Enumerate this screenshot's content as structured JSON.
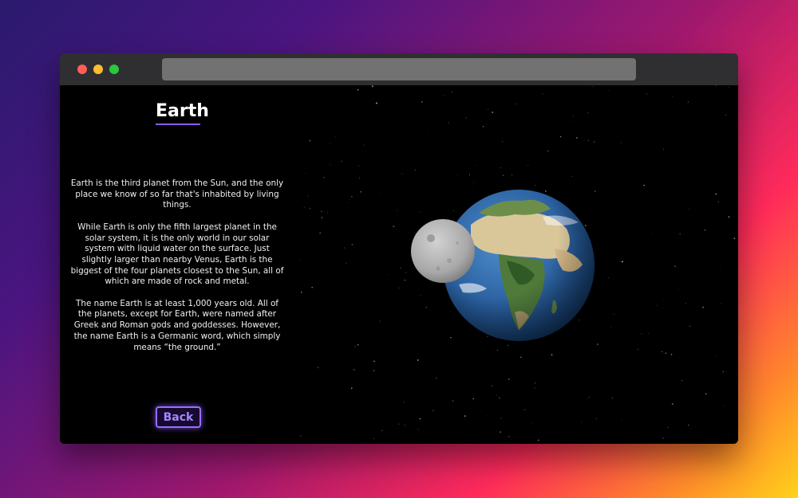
{
  "page": {
    "title": "Earth",
    "paragraphs": [
      "Earth is the third planet from the Sun, and the only place we know of so far that's inhabited by living things.",
      "While Earth is only the fifth largest planet in the solar system, it is the only world in our solar system with liquid water on the surface. Just slightly larger than nearby Venus, Earth is the biggest of the four planets closest to the Sun, all of which are made of rock and metal.",
      "The name Earth is at least 1,000 years old. All of the planets, except for Earth, were named after Greek and Roman gods and goddesses. However, the name Earth is a Germanic word, which simply means “the ground.”"
    ],
    "back_label": "Back"
  },
  "colors": {
    "accent": "#8a5cf0",
    "background": "#000000",
    "ocean": "#2f6cb0",
    "moon": "#b8b8b8"
  },
  "icons": {
    "window_controls": [
      "close-dot",
      "minimize-dot",
      "zoom-dot"
    ]
  }
}
